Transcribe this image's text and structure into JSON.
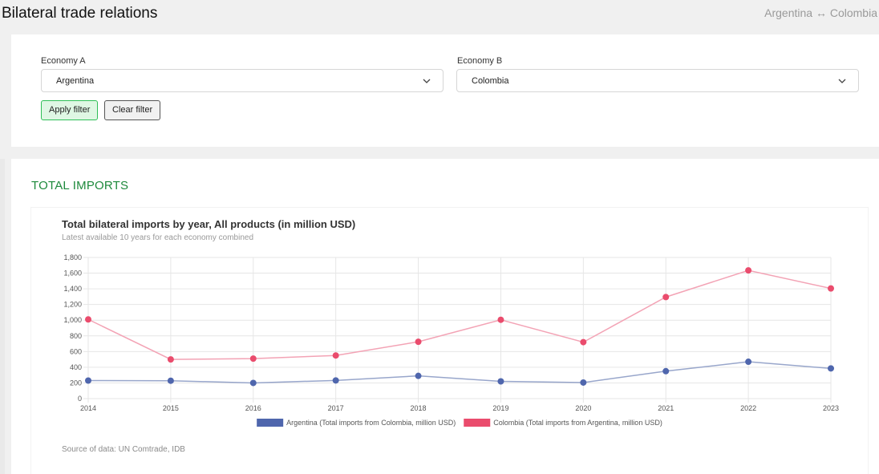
{
  "header": {
    "title": "Bilateral trade relations",
    "breadcrumb": "Argentina ↔ Colombia"
  },
  "filters": {
    "economy_a_label": "Economy A",
    "economy_a_value": "Argentina",
    "economy_b_label": "Economy B",
    "economy_b_value": "Colombia",
    "apply_label": "Apply filter",
    "clear_label": "Clear filter"
  },
  "section": {
    "title": "TOTAL IMPORTS",
    "source": "Source of data: UN Comtrade, IDB"
  },
  "chart_data": {
    "type": "line",
    "title": "Total bilateral imports by year, All products (in million USD)",
    "subtitle": "Latest available 10 years for each economy combined",
    "x": [
      2014,
      2015,
      2016,
      2017,
      2018,
      2019,
      2020,
      2021,
      2022,
      2023
    ],
    "ylim": [
      0,
      1800
    ],
    "yticks": [
      0,
      200,
      400,
      600,
      800,
      1000,
      1200,
      1400,
      1600,
      1800
    ],
    "grid": true,
    "legend_position": "bottom",
    "series": [
      {
        "name": "Argentina (Total imports from Colombia, million USD)",
        "color": "#4f66ad",
        "line_color": "#98a6cb",
        "values": [
          230,
          228,
          200,
          232,
          290,
          220,
          205,
          350,
          470,
          385
        ]
      },
      {
        "name": "Colombia (Total imports from Argentina, million USD)",
        "color": "#ea4c6d",
        "line_color": "#f3a3b5",
        "values": [
          1010,
          500,
          510,
          550,
          725,
          1005,
          720,
          1295,
          1635,
          1405
        ]
      }
    ]
  }
}
